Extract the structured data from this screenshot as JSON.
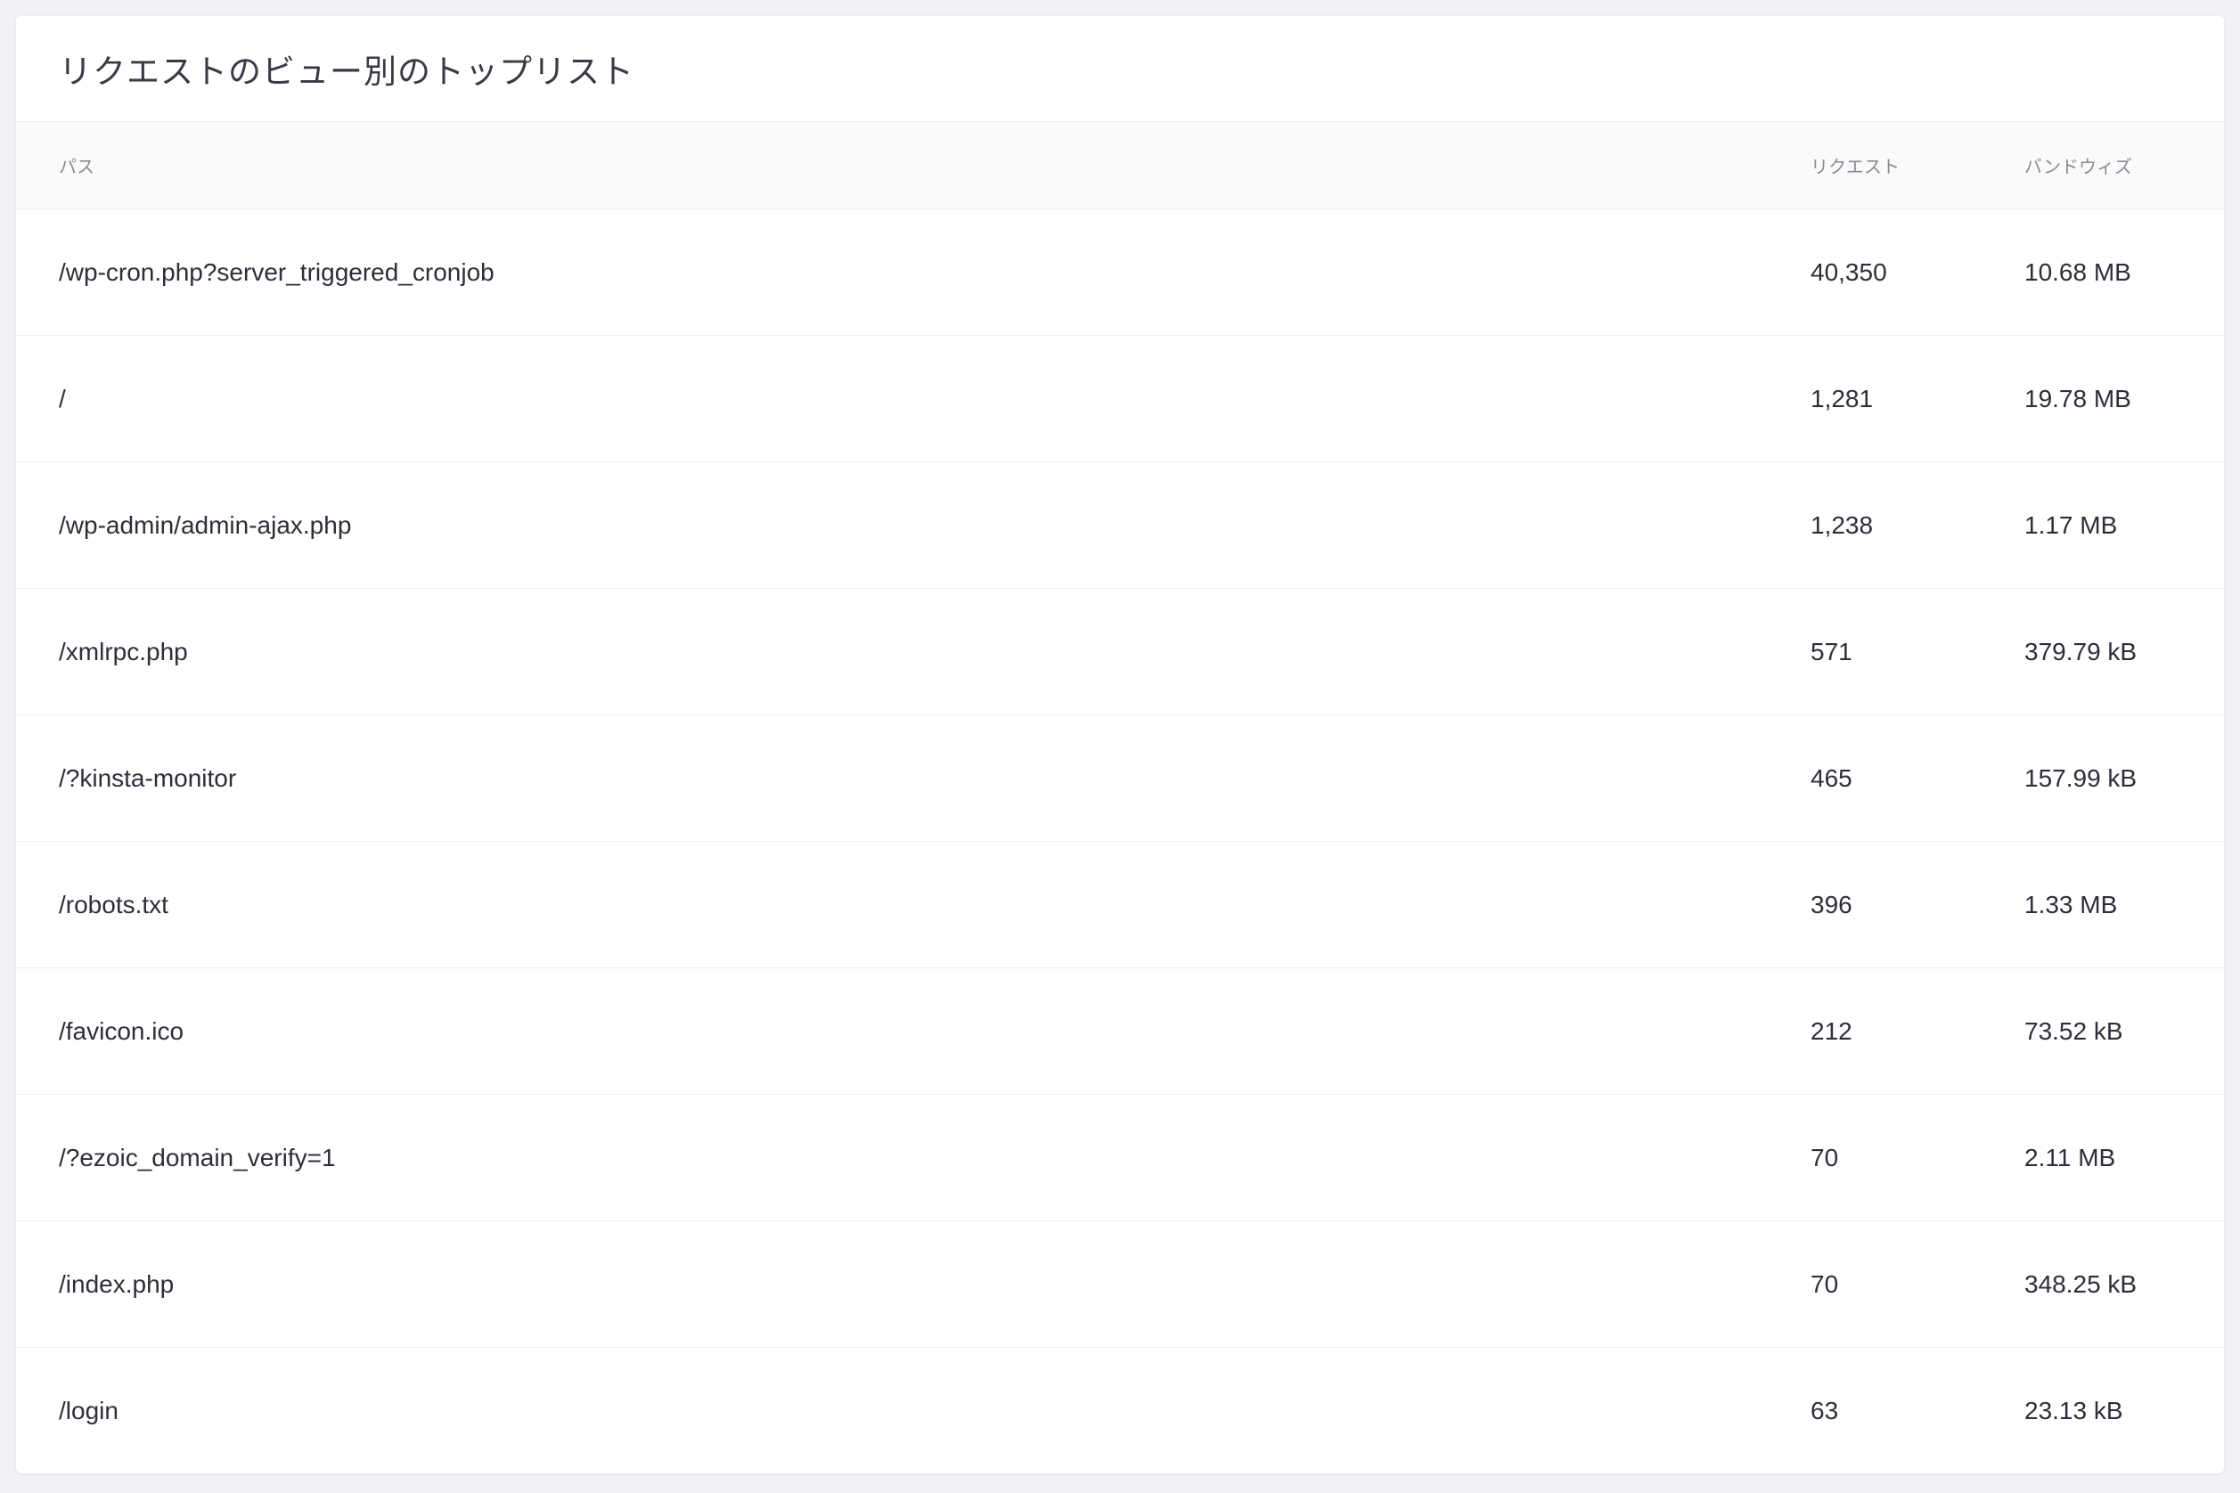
{
  "card": {
    "title": "リクエストのビュー別のトップリスト"
  },
  "table": {
    "headers": {
      "path": "パス",
      "requests": "リクエスト",
      "bandwidth": "バンドウィズ"
    },
    "rows": [
      {
        "path": "/wp-cron.php?server_triggered_cronjob",
        "requests": "40,350",
        "bandwidth": "10.68 MB"
      },
      {
        "path": "/",
        "requests": "1,281",
        "bandwidth": "19.78 MB"
      },
      {
        "path": "/wp-admin/admin-ajax.php",
        "requests": "1,238",
        "bandwidth": "1.17 MB"
      },
      {
        "path": "/xmlrpc.php",
        "requests": "571",
        "bandwidth": "379.79 kB"
      },
      {
        "path": "/?kinsta-monitor",
        "requests": "465",
        "bandwidth": "157.99 kB"
      },
      {
        "path": "/robots.txt",
        "requests": "396",
        "bandwidth": "1.33 MB"
      },
      {
        "path": "/favicon.ico",
        "requests": "212",
        "bandwidth": "73.52 kB"
      },
      {
        "path": "/?ezoic_domain_verify=1",
        "requests": "70",
        "bandwidth": "2.11 MB"
      },
      {
        "path": "/index.php",
        "requests": "70",
        "bandwidth": "348.25 kB"
      },
      {
        "path": "/login",
        "requests": "63",
        "bandwidth": "23.13 kB"
      }
    ]
  }
}
